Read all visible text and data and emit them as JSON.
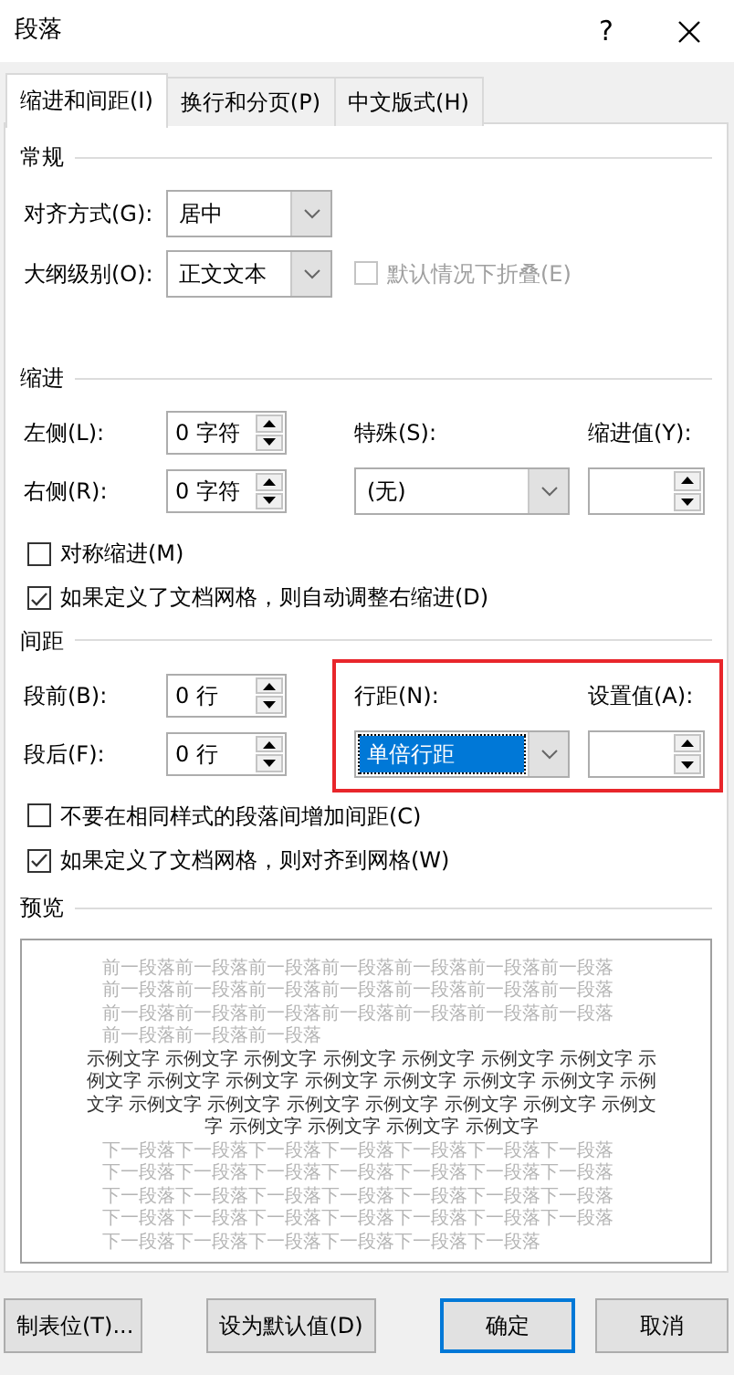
{
  "window": {
    "title": "段落",
    "help": "?"
  },
  "tabs": [
    {
      "label": "缩进和间距(I)",
      "selected": true
    },
    {
      "label": "换行和分页(P)",
      "selected": false
    },
    {
      "label": "中文版式(H)",
      "selected": false
    }
  ],
  "general": {
    "heading": "常规",
    "alignment": {
      "label": "对齐方式(G):",
      "value": "居中"
    },
    "outline_level": {
      "label": "大纲级别(O):",
      "value": "正文文本"
    },
    "collapse": {
      "label": "默认情况下折叠(E)",
      "checked": false,
      "disabled": true
    }
  },
  "indent": {
    "heading": "缩进",
    "left": {
      "label": "左侧(L):",
      "value": "0 字符"
    },
    "right": {
      "label": "右侧(R):",
      "value": "0 字符"
    },
    "special": {
      "label": "特殊(S):",
      "value": "(无)",
      "focused": false
    },
    "by": {
      "label": "缩进值(Y):"
    },
    "checkboxes": [
      {
        "label": "对称缩进(M)",
        "checked": false
      },
      {
        "label": "如果定义了文档网格，则自动调整右缩进(D)",
        "checked": true
      }
    ]
  },
  "spacing": {
    "heading": "间距",
    "left": {
      "label": "段前(B):",
      "value": "0 行"
    },
    "right": {
      "label": "段后(F):",
      "value": "0 行"
    },
    "special": {
      "label": "行距(N):",
      "value": "单倍行距",
      "focused": true
    },
    "by": {
      "label": "设置值(A):"
    },
    "highlighted": true,
    "checkboxes": [
      {
        "label": "不要在相同样式的段落间增加间距(C)",
        "checked": false
      },
      {
        "label": "如果定义了文档网格，则对齐到网格(W)",
        "checked": true
      }
    ]
  },
  "preview": {
    "heading": "预览",
    "previous_text": "前一段落前一段落前一段落前一段落前一段落前一段落前一段落前一段落前一段落前一段落前一段落前一段落前一段落前一段落前一段落前一段落前一段落前一段落前一段落前一段落前一段落前一段落前一段落前一段落",
    "sample_text": "示例文字 示例文字 示例文字 示例文字 示例文字 示例文字 示例文字 示例文字 示例文字 示例文字 示例文字 示例文字 示例文字 示例文字 示例文字 示例文字 示例文字 示例文字 示例文字 示例文字 示例文字 示例文字 示例文字 示例文字 示例文字 示例文字",
    "next_text": "下一段落下一段落下一段落下一段落下一段落下一段落下一段落下一段落下一段落下一段落下一段落下一段落下一段落下一段落下一段落下一段落下一段落下一段落下一段落下一段落下一段落下一段落下一段落下一段落下一段落下一段落下一段落下一段落下一段落下一段落下一段落下一段落下一段落下一段落"
  },
  "buttons": [
    {
      "label": "制表位(T)...",
      "default": false
    },
    {
      "label": "设为默认值(D)",
      "default": false
    },
    {
      "label": "确定",
      "default": true
    },
    {
      "label": "取消",
      "default": false
    }
  ]
}
